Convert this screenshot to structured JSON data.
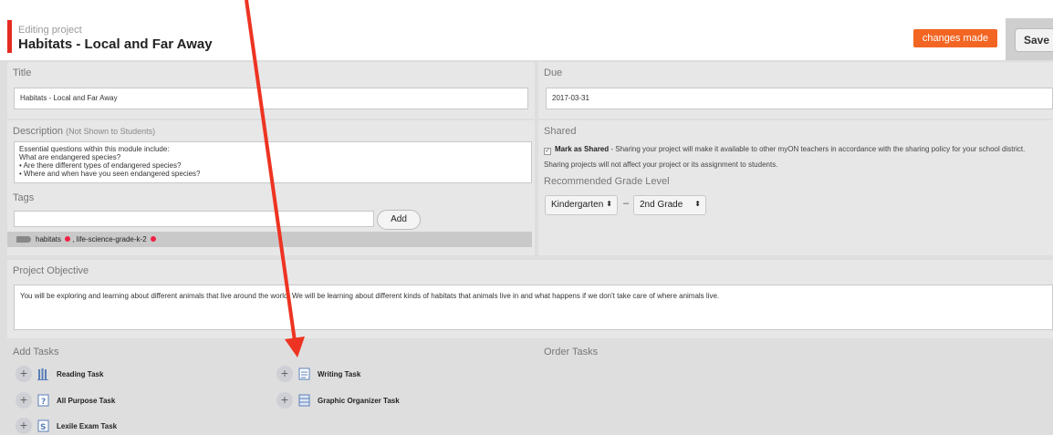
{
  "header": {
    "subtitle": "Editing project",
    "title": "Habitats - Local and Far Away",
    "changes_badge": "changes made",
    "save_label": "Save"
  },
  "title_field": {
    "label": "Title",
    "value": "Habitats - Local and Far Away"
  },
  "due_field": {
    "label": "Due",
    "value": "2017-03-31"
  },
  "description": {
    "label": "Description",
    "note": "(Not Shown to Students)",
    "lines": [
      "Essential questions within this module include:",
      "What are endangered species?",
      "• Are there different types of endangered species?",
      "• Where and when have you seen endangered species?"
    ]
  },
  "shared": {
    "label": "Shared",
    "checkbox_title": "Mark as Shared",
    "checkbox_text": " - Sharing your project will make it available to other myON teachers in accordance with the sharing policy for your school district. Sharing projects will not affect your project or its assignment to students."
  },
  "grade": {
    "label": "Recommended Grade Level",
    "from": "Kindergarten",
    "separator": "–",
    "to": "2nd Grade"
  },
  "tags": {
    "label": "Tags",
    "input_value": "",
    "add_label": "Add",
    "items": [
      "habitats",
      "life-science-grade-k-2"
    ],
    "separator": ","
  },
  "objective": {
    "label": "Project Objective",
    "value": "You will be exploring and learning about different animals that live around the world.  We will be learning about different kinds of habitats that animals live in and what happens if we don't take care of where animals live."
  },
  "add_tasks": {
    "label": "Add Tasks",
    "tasks": [
      {
        "label": "Reading Task",
        "icon": "books-icon"
      },
      {
        "label": "Writing Task",
        "icon": "notepad-icon"
      },
      {
        "label": "All Purpose Task",
        "icon": "question-doc-icon"
      },
      {
        "label": "Graphic Organizer Task",
        "icon": "list-grid-icon"
      },
      {
        "label": "Lexile Exam Task",
        "icon": "exam-icon"
      }
    ]
  },
  "order_tasks": {
    "label": "Order Tasks"
  },
  "colors": {
    "accent_red": "#e52b20",
    "badge_orange": "#f26522",
    "annotation_arrow": "#ee3322"
  }
}
